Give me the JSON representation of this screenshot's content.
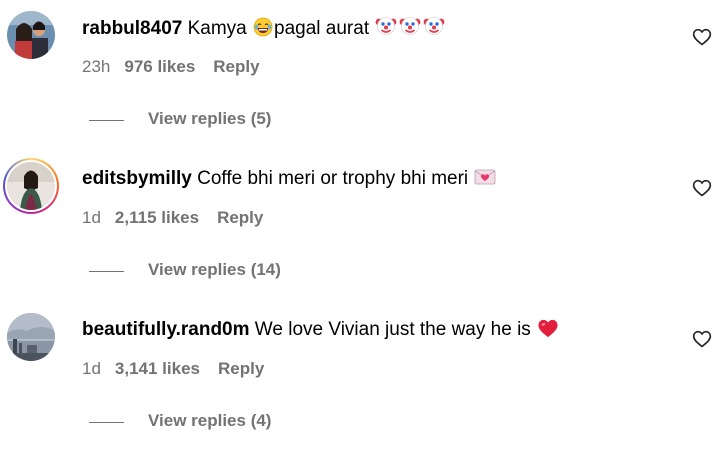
{
  "comments": [
    {
      "username": "rabbul8407",
      "text_before": "Kamya",
      "text_after": "pagal aurat",
      "emojis": [
        "rolling-laughing-emoji",
        "clown-emoji",
        "clown-emoji",
        "clown-emoji"
      ],
      "time": "23h",
      "likes": "976 likes",
      "reply": "Reply",
      "view_replies": "View replies (5)"
    },
    {
      "username": "editsbymilly",
      "text": "Coffe bhi meri or trophy bhi meri",
      "emojis": [
        "love-letter-emoji"
      ],
      "time": "1d",
      "likes": "2,115 likes",
      "reply": "Reply",
      "view_replies": "View replies (14)"
    },
    {
      "username": "beautifully.rand0m",
      "text": "We love Vivian just the way he is",
      "emojis": [
        "red-heart-emoji"
      ],
      "time": "1d",
      "likes": "3,141 likes",
      "reply": "Reply",
      "view_replies": "View replies (4)"
    }
  ],
  "colors": {
    "text": "#000000",
    "muted": "#737373",
    "heart": "#e0245e"
  }
}
